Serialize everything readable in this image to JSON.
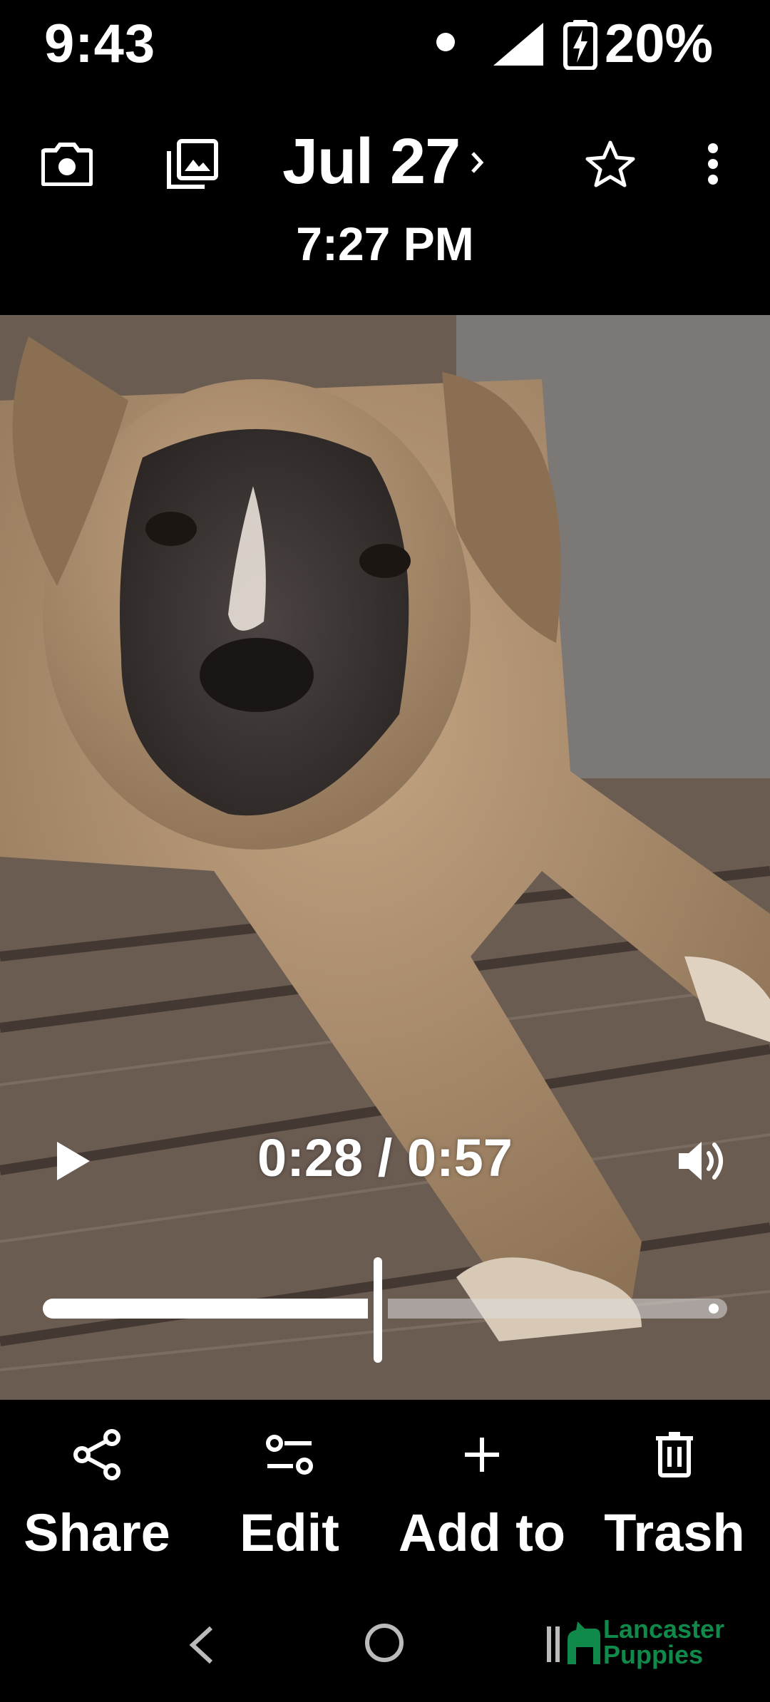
{
  "status_bar": {
    "time": "9:43",
    "battery_percent": "20%",
    "icons": [
      "notification-dot-icon",
      "signal-icon",
      "battery-charging-icon"
    ]
  },
  "top_bar": {
    "date": "Jul 27",
    "time": "7:27 PM",
    "icons": [
      "camera-icon",
      "gallery-icon",
      "chevron-right-icon",
      "star-icon",
      "more-vert-icon"
    ]
  },
  "video": {
    "position_label": "0:28 / 0:57",
    "progress_fraction": 0.49,
    "icons": [
      "play-icon",
      "volume-icon"
    ]
  },
  "actions": [
    {
      "label": "Share",
      "icon": "share-icon"
    },
    {
      "label": "Edit",
      "icon": "edit-sliders-icon"
    },
    {
      "label": "Add to",
      "icon": "plus-icon"
    },
    {
      "label": "Trash",
      "icon": "trash-icon"
    }
  ],
  "nav_bar": {
    "icons": [
      "back-icon",
      "home-icon",
      "recents-icon"
    ]
  },
  "watermark": {
    "line1": "Lancaster",
    "line2": "Puppies",
    "color": "#0f8a4a"
  }
}
